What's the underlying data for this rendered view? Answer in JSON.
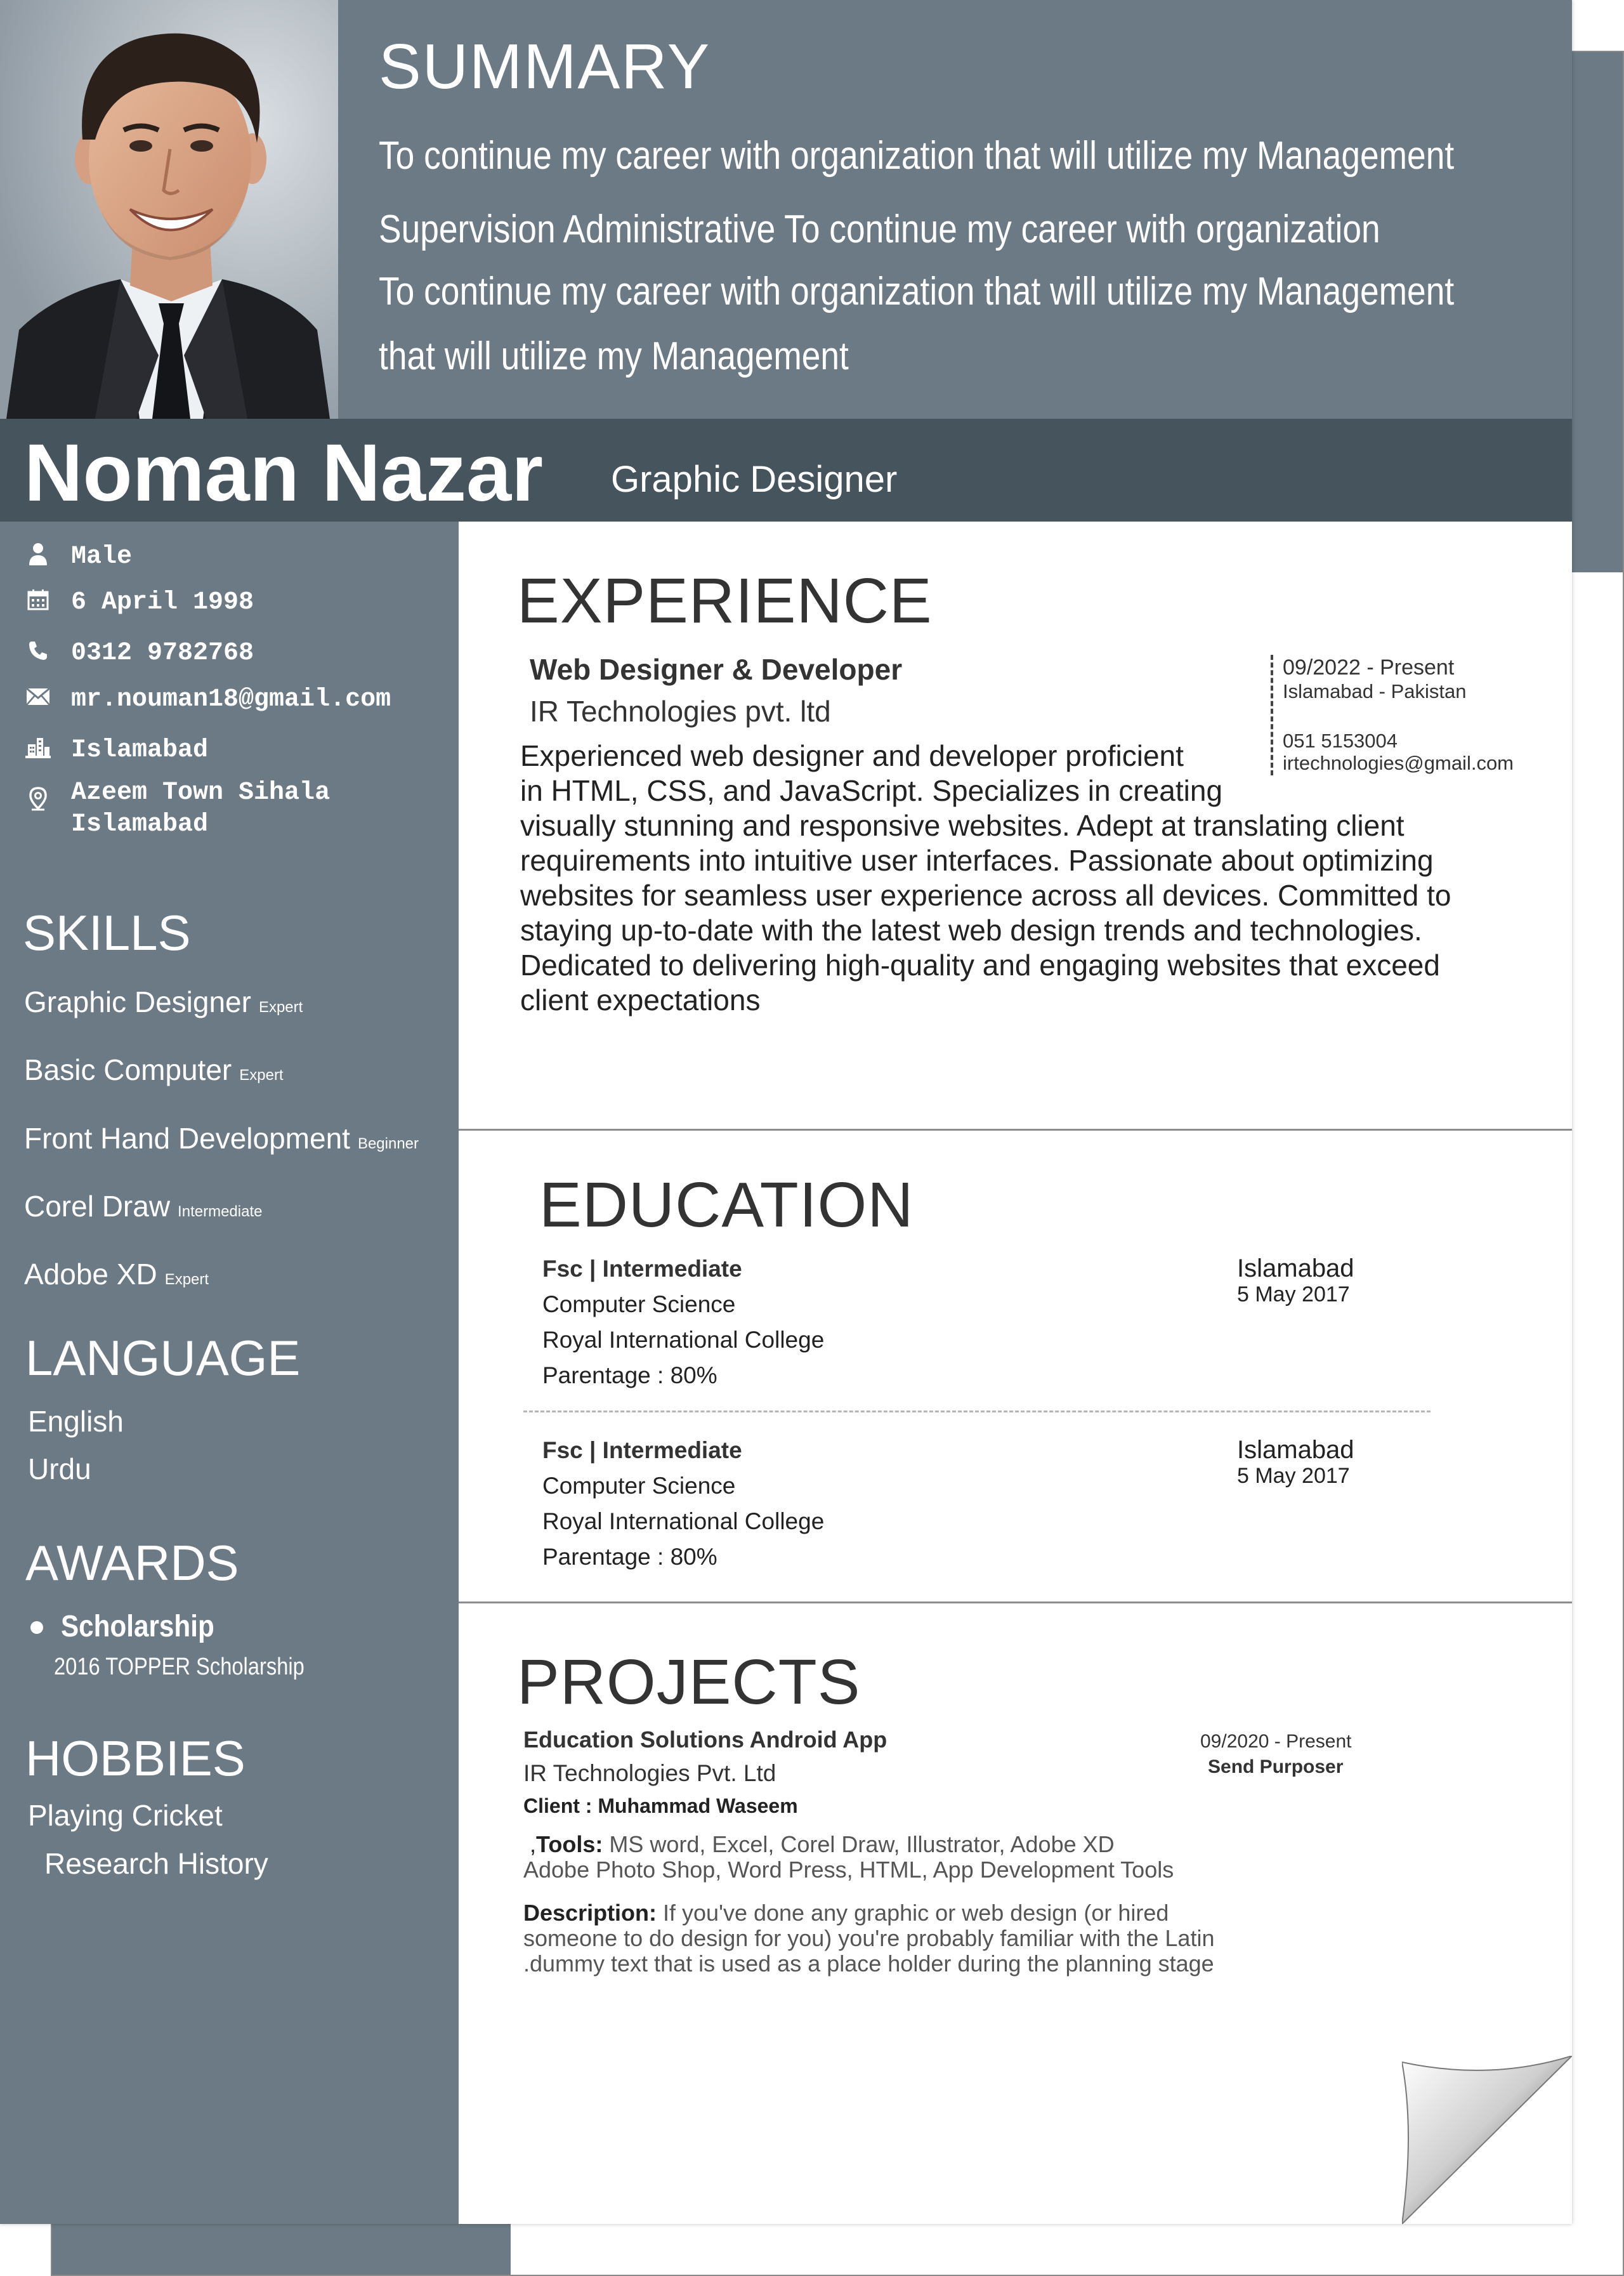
{
  "header": {
    "summary_title": "SUMMARY",
    "summary_lines": [
      "To continue my career with organization that will utilize my Management",
      "Supervision Administrative To continue my career with organization",
      "To continue my career with organization that will utilize my Management",
      "that will utilize my Management"
    ],
    "name": "Noman Nazar",
    "job_title": "Graphic Designer"
  },
  "personal_info": [
    {
      "icon": "person-icon",
      "text": "Male"
    },
    {
      "icon": "calendar-icon",
      "text": "6 April 1998"
    },
    {
      "icon": "phone-icon",
      "text": "0312 9782768"
    },
    {
      "icon": "envelope-icon",
      "text": "mr.nouman18@gmail.com"
    },
    {
      "icon": "city-icon",
      "text": "Islamabad"
    },
    {
      "icon": "location-pin-icon",
      "text": "Azeem Town Sihala\nIslamabad"
    }
  ],
  "skills": {
    "title": "SKILLS",
    "items": [
      {
        "name": "Graphic Designer",
        "level": "Expert"
      },
      {
        "name": "Basic Computer",
        "level": "Expert"
      },
      {
        "name": "Front Hand Development",
        "level": "Beginner"
      },
      {
        "name": "Corel Draw",
        "level": "Intermediate"
      },
      {
        "name": "Adobe XD",
        "level": "Expert"
      }
    ]
  },
  "language": {
    "title": "LANGUAGE",
    "items": [
      "English",
      "Urdu"
    ]
  },
  "awards": {
    "title": "AWARDS",
    "name": "Scholarship",
    "detail": "2016 TOPPER Scholarship"
  },
  "hobbies": {
    "title": "HOBBIES",
    "items": [
      "Playing Cricket",
      "Research History"
    ]
  },
  "experience": {
    "title": "EXPERIENCE",
    "role": "Web Designer & Developer",
    "company": "IR Technologies pvt. ltd",
    "dates": "09/2022 - Present",
    "location": "Islamabad - Pakistan",
    "phone": "051 5153004",
    "email": "irtechnologies@gmail.com",
    "description_lines": [
      "Experienced web designer and developer proficient",
      "in HTML, CSS, and JavaScript. Specializes in creating",
      "visually stunning and responsive websites. Adept at translating client",
      "requirements into intuitive user interfaces. Passionate about optimizing",
      "websites for seamless user experience across all devices. Committed to",
      "staying up-to-date with the latest web design trends and technologies.",
      "Dedicated to delivering high-quality and engaging websites that exceed",
      " client expectations"
    ]
  },
  "education": {
    "title": "EDUCATION",
    "entries": [
      {
        "degree": "Fsc | Intermediate",
        "field": "Computer Science",
        "institute": "Royal International College",
        "grade": "Parentage : 80%",
        "city": "Islamabad",
        "date": "5 May 2017"
      },
      {
        "degree": "Fsc | Intermediate",
        "field": "Computer Science",
        "institute": "Royal International College",
        "grade": "Parentage : 80%",
        "city": "Islamabad",
        "date": "5 May 2017"
      }
    ]
  },
  "projects": {
    "title": "PROJECTS",
    "name": "Education Solutions Android App",
    "company": "IR Technologies Pvt. Ltd",
    "client": "Client : Muhammad Waseem",
    "dates": "09/2020 - Present",
    "status": "Send Purposer",
    "tools_label": "Tools:",
    "tools_prefix": ",",
    "tools_line1": " MS word, Excel, Corel Draw, Illustrator, Adobe XD",
    "tools_line2": "Adobe Photo Shop, Word Press, HTML, App Development Tools",
    "description_label": "Description:",
    "description_line1": " If you've done any graphic or web design (or hired",
    "description_line2": "someone to do design for you) you're probably familiar with the Latin",
    "description_line3": " .dummy text that is used as a place holder during the planning stage"
  },
  "colors": {
    "band": "#6b7a84",
    "name_bar": "#45545d",
    "heading_text": "#333333"
  }
}
